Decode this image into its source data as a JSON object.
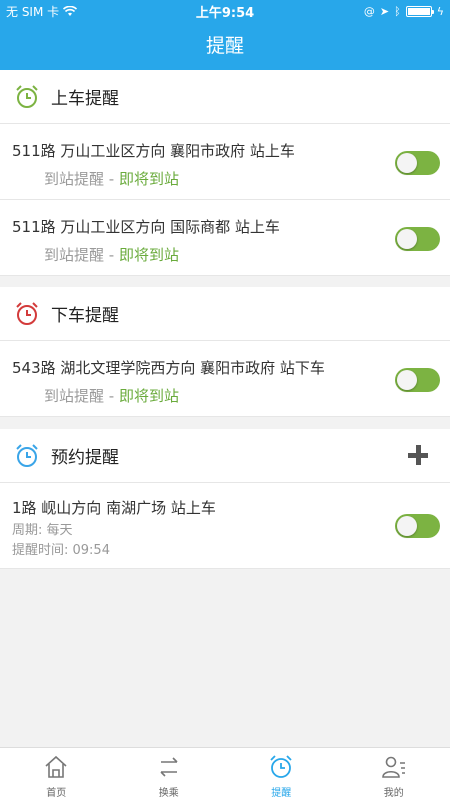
{
  "statusbar": {
    "carrier": "无 SIM 卡",
    "time": "上午9:54"
  },
  "header": {
    "title": "提醒"
  },
  "board": {
    "title": "上车提醒",
    "icon": "alarm-clock-green-icon",
    "items": [
      {
        "line": "511路  万山工业区方向   襄阳市政府 站上车",
        "reminder_label": "到站提醒 - ",
        "reminder_status": "即将到站",
        "enabled": true
      },
      {
        "line": "511路  万山工业区方向   国际商都 站上车",
        "reminder_label": "到站提醒 - ",
        "reminder_status": "即将到站",
        "enabled": true
      }
    ]
  },
  "alight": {
    "title": "下车提醒",
    "icon": "alarm-clock-red-icon",
    "items": [
      {
        "line": "543路  湖北文理学院西方向   襄阳市政府 站下车",
        "reminder_label": "到站提醒 - ",
        "reminder_status": "即将到站",
        "enabled": true
      }
    ]
  },
  "scheduled": {
    "title": "预约提醒",
    "icon": "alarm-clock-blue-icon",
    "items": [
      {
        "line": "1路  岘山方向   南湖广场 站上车",
        "period": "周期: 每天",
        "time": "提醒时间: 09:54",
        "enabled": true
      }
    ]
  },
  "tabs": [
    {
      "label": "首页",
      "icon": "home-icon",
      "active": false
    },
    {
      "label": "换乘",
      "icon": "transfer-icon",
      "active": false
    },
    {
      "label": "提醒",
      "icon": "alarm-clock-icon",
      "active": true
    },
    {
      "label": "我的",
      "icon": "profile-icon",
      "active": false
    }
  ],
  "colors": {
    "primary": "#28a7ea",
    "toggle_on": "#7cb342",
    "status_green": "#6aab3c",
    "board_icon": "#7cb342",
    "alight_icon": "#d33b3b",
    "scheduled_icon": "#3aa5e8"
  }
}
